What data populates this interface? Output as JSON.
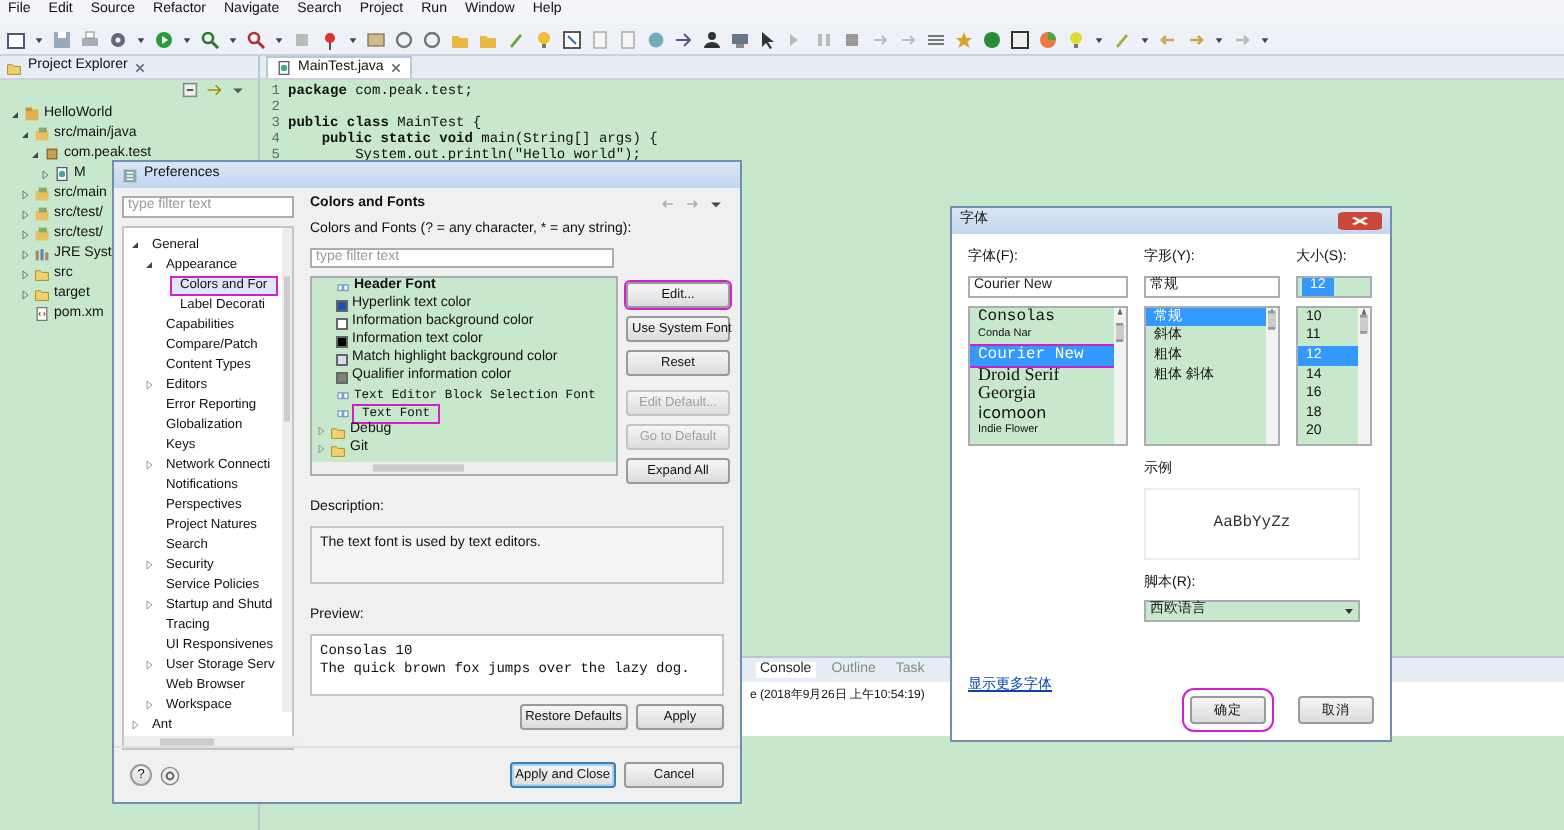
{
  "menu": [
    "File",
    "Edit",
    "Source",
    "Refactor",
    "Navigate",
    "Search",
    "Project",
    "Run",
    "Window",
    "Help"
  ],
  "project_explorer": {
    "title": "Project Explorer",
    "tree": [
      {
        "label": "HelloWorld",
        "kind": "project",
        "expanded": true,
        "children": [
          {
            "label": "src/main/java",
            "kind": "source",
            "expanded": true,
            "children": [
              {
                "label": "com.peak.test",
                "kind": "package",
                "expanded": true,
                "children": [
                  {
                    "label": "M",
                    "kind": "java",
                    "expanded": false
                  }
                ]
              }
            ]
          },
          {
            "label": "src/main",
            "kind": "source",
            "expanded": false
          },
          {
            "label": "src/test/",
            "kind": "source",
            "expanded": false
          },
          {
            "label": "src/test/",
            "kind": "source",
            "expanded": false
          },
          {
            "label": "JRE Syst",
            "kind": "library",
            "expanded": false
          },
          {
            "label": "src",
            "kind": "folder",
            "expanded": false
          },
          {
            "label": "target",
            "kind": "folder",
            "expanded": false
          },
          {
            "label": "pom.xm",
            "kind": "xml"
          }
        ]
      }
    ]
  },
  "editor": {
    "tab": "MainTest.java",
    "lines": [
      {
        "number": "1",
        "code": "**package** com.peak.test;"
      },
      {
        "number": "2"
      },
      {
        "number": "3",
        "code": "**public class** MainTest {"
      },
      {
        "number": "4",
        "code": "    **public static void** main(String[] args) {"
      },
      {
        "number": "5",
        "code": "        System.out.println(\"Hello world\");"
      }
    ]
  },
  "console": {
    "tabs": [
      {
        "label": "Console",
        "selected": true
      },
      {
        "label": "Outline",
        "selected": false
      },
      {
        "label": "Task",
        "selected": false
      }
    ],
    "text": "e (2018年9月26日 上午10:54:19)"
  },
  "preferences": {
    "title": "Preferences",
    "filter_placeholder": "type filter text",
    "tree": [
      {
        "label": "General",
        "expanded": true,
        "selected": false,
        "children": [
          {
            "label": "Appearance",
            "expanded": true,
            "selected": false,
            "children": [
              {
                "label": "Colors and For",
                "selected": true,
                "highlighted": true
              },
              {
                "label": "Label Decorati",
                "selected": false
              }
            ]
          },
          {
            "label": "Capabilities",
            "selected": false
          },
          {
            "label": "Compare/Patch",
            "selected": false
          },
          {
            "label": "Content Types",
            "selected": false
          },
          {
            "label": "Editors",
            "expanded": false,
            "selected": false
          },
          {
            "label": "Error Reporting",
            "selected": false
          },
          {
            "label": "Globalization",
            "selected": false
          },
          {
            "label": "Keys",
            "selected": false
          },
          {
            "label": "Network Connecti",
            "expanded": false,
            "selected": false
          },
          {
            "label": "Notifications",
            "selected": false
          },
          {
            "label": "Perspectives",
            "selected": false
          },
          {
            "label": "Project Natures",
            "selected": false
          },
          {
            "label": "Search",
            "selected": false
          },
          {
            "label": "Security",
            "expanded": false,
            "selected": false
          },
          {
            "label": "Service Policies",
            "selected": false
          },
          {
            "label": "Startup and Shutd",
            "expanded": false,
            "selected": false
          },
          {
            "label": "Tracing",
            "selected": false
          },
          {
            "label": "UI Responsivenes",
            "selected": false
          },
          {
            "label": "User Storage Serv",
            "expanded": false,
            "selected": false
          },
          {
            "label": "Web Browser",
            "selected": false
          },
          {
            "label": "Workspace",
            "expanded": false,
            "selected": false
          }
        ]
      },
      {
        "label": "Ant",
        "expanded": false,
        "selected": false
      }
    ],
    "page_title": "Colors and Fonts",
    "list_label": "Colors and Fonts (? = any character, * = any string):",
    "list_filter_placeholder": "type filter text",
    "items": [
      {
        "kind": "bold-font",
        "label": "Header Font",
        "highlighted": false
      },
      {
        "kind": "color",
        "label": "Hyperlink text color",
        "color": "#2050b0",
        "highlighted": false
      },
      {
        "kind": "color",
        "label": "Information background color",
        "color": "#ffffff",
        "highlighted": false
      },
      {
        "kind": "color",
        "label": "Information text color",
        "color": "#000000",
        "highlighted": false
      },
      {
        "kind": "color",
        "label": "Match highlight background color",
        "color": "#d4dcee",
        "highlighted": false
      },
      {
        "kind": "color",
        "label": "Qualifier information color",
        "color": "#808080",
        "highlighted": false
      },
      {
        "kind": "mono-font",
        "label": "Text Editor Block Selection Font",
        "highlighted": false
      },
      {
        "kind": "mono-font",
        "label": "Text Font",
        "highlighted": true
      },
      {
        "kind": "category",
        "label": "Debug",
        "expanded": false,
        "highlighted": false
      },
      {
        "kind": "category",
        "label": "Git",
        "expanded": false,
        "highlighted": false
      }
    ],
    "side_buttons": [
      {
        "label": "Edit...",
        "disabled": false,
        "highlighted": true
      },
      {
        "label": "Use System Font",
        "disabled": false,
        "highlighted": false
      },
      {
        "label": "Reset",
        "disabled": false,
        "highlighted": false
      },
      {
        "label": "Edit Default...",
        "disabled": true,
        "highlighted": false
      },
      {
        "label": "Go to Default",
        "disabled": true,
        "highlighted": false
      },
      {
        "label": "Expand All",
        "disabled": false,
        "highlighted": false
      }
    ],
    "description_label": "Description:",
    "description": "The text font is used by text editors.",
    "preview_label": "Preview:",
    "preview": [
      "Consolas 10",
      "The quick brown fox jumps over the lazy dog."
    ],
    "page_buttons": [
      "Restore Defaults",
      "Apply"
    ],
    "help_button": "?",
    "dialog_buttons": [
      {
        "label": "Apply and Close",
        "default": true
      },
      {
        "label": "Cancel",
        "default": false
      }
    ]
  },
  "font_dialog": {
    "title": "字体",
    "font": {
      "label": "字体(F):",
      "value": "Courier New",
      "options": [
        {
          "label": "Consolas",
          "kind": "mono",
          "selected": false,
          "highlighted": false
        },
        {
          "label": "Conda Nar",
          "kind": "small",
          "selected": false,
          "highlighted": false
        },
        {
          "label": "Courier New",
          "kind": "mono",
          "selected": true,
          "highlighted": true
        },
        {
          "label": "Droid Serif",
          "kind": "serif",
          "selected": false,
          "highlighted": false
        },
        {
          "label": "Georgia",
          "kind": "serif",
          "selected": false,
          "highlighted": false
        },
        {
          "label": "icomoon",
          "kind": "sans",
          "selected": false,
          "highlighted": false
        },
        {
          "label": "Indie Flower",
          "kind": "small",
          "selected": false,
          "highlighted": false
        }
      ]
    },
    "style": {
      "label": "字形(Y):",
      "value": "常规",
      "options": [
        {
          "label": "常规",
          "selected": true
        },
        {
          "label": "斜体",
          "selected": false
        },
        {
          "label": "粗体",
          "selected": false
        },
        {
          "label": "粗体 斜体",
          "selected": false
        }
      ]
    },
    "size": {
      "label": "大小(S):",
      "value": "12",
      "options": [
        {
          "label": "10",
          "selected": false
        },
        {
          "label": "11",
          "selected": false
        },
        {
          "label": "12",
          "selected": true
        },
        {
          "label": "14",
          "selected": false
        },
        {
          "label": "16",
          "selected": false
        },
        {
          "label": "18",
          "selected": false
        },
        {
          "label": "20",
          "selected": false
        }
      ]
    },
    "sample_label": "示例",
    "sample": "AaBbYyZz",
    "script_label": "脚本(R):",
    "script": "西欧语言",
    "more_link": "显示更多字体",
    "buttons": [
      {
        "label": "确定",
        "highlighted": true
      },
      {
        "label": "取消",
        "highlighted": false
      }
    ]
  }
}
